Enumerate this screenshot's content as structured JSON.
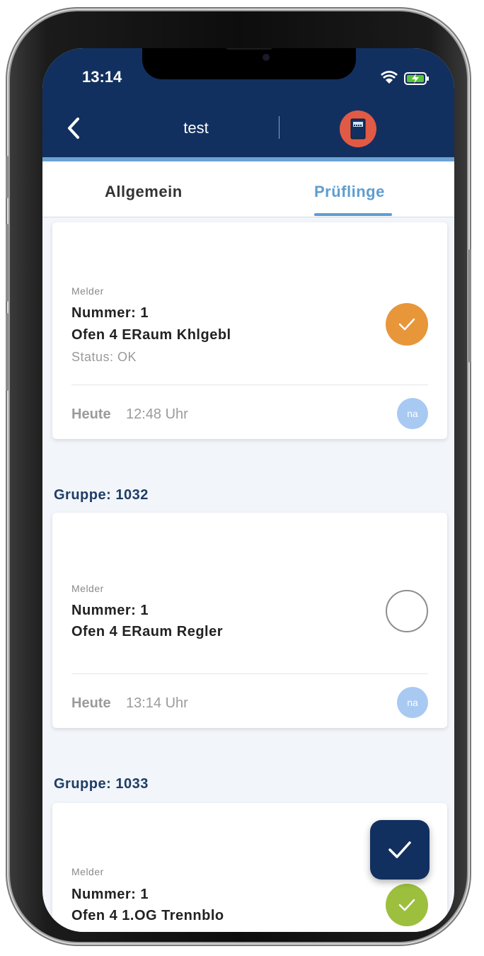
{
  "status_bar": {
    "time": "13:14"
  },
  "header": {
    "title": "test",
    "back_label": "back",
    "device_icon": "device-icon"
  },
  "tabs": [
    {
      "label": "Allgemein",
      "active": false
    },
    {
      "label": "Prüflinge",
      "active": true
    }
  ],
  "cards": [
    {
      "type": "Melder",
      "number": "Nummer: 1",
      "name": "Ofen 4 ERaum Khlgebl",
      "status": "Status: OK",
      "day": "Heute",
      "time": "12:48 Uhr",
      "badge": "na",
      "state": "checked-orange"
    },
    {
      "group": "Gruppe: 1032",
      "type": "Melder",
      "number": "Nummer: 1",
      "name": "Ofen 4 ERaum Regler",
      "day": "Heute",
      "time": "13:14 Uhr",
      "badge": "na",
      "state": "unchecked"
    },
    {
      "group": "Gruppe: 1033",
      "type": "Melder",
      "number": "Nummer: 1",
      "name": "Ofen 4 1.OG Trennblo",
      "state": "checked-green"
    }
  ],
  "fab": {
    "icon": "check-icon"
  },
  "colors": {
    "header": "#12305f",
    "accent": "#5f9dcf",
    "orange": "#e8963a",
    "green": "#9cbf3e",
    "device": "#e15a45"
  }
}
